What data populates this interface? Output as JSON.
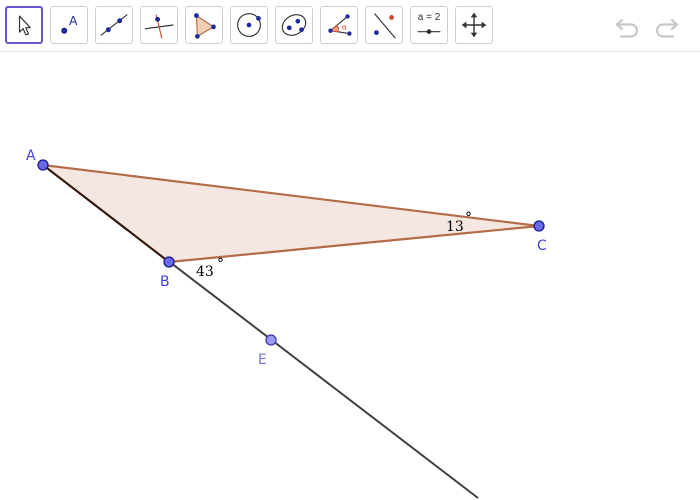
{
  "toolbar": {
    "tools": [
      {
        "name": "move-tool",
        "active": true
      },
      {
        "name": "point-tool"
      },
      {
        "name": "line-tool"
      },
      {
        "name": "perpendicular-line-tool"
      },
      {
        "name": "polygon-tool"
      },
      {
        "name": "circle-tool"
      },
      {
        "name": "conic-tool"
      },
      {
        "name": "angle-tool"
      },
      {
        "name": "reflect-tool"
      },
      {
        "name": "slider-tool",
        "label": "a = 2"
      },
      {
        "name": "move-graphics-view-tool"
      }
    ],
    "undo_icon": "undo-icon",
    "redo_icon": "redo-icon"
  },
  "graphics": {
    "points": {
      "A": {
        "label": "A"
      },
      "B": {
        "label": "B"
      },
      "C": {
        "label": "C"
      },
      "E": {
        "label": "E"
      }
    },
    "angles": {
      "at_B": "43",
      "at_C": "13"
    },
    "degree_symbol": "°",
    "colors": {
      "polygon_fill": "#f4e7e1",
      "polygon_edge": "#b36b48",
      "point_fill": "#6a6ae8",
      "point_stroke": "#1a1a8c",
      "point_label": "#4343d9",
      "ray": "#404040",
      "active_tool_border": "#6557d2"
    }
  }
}
